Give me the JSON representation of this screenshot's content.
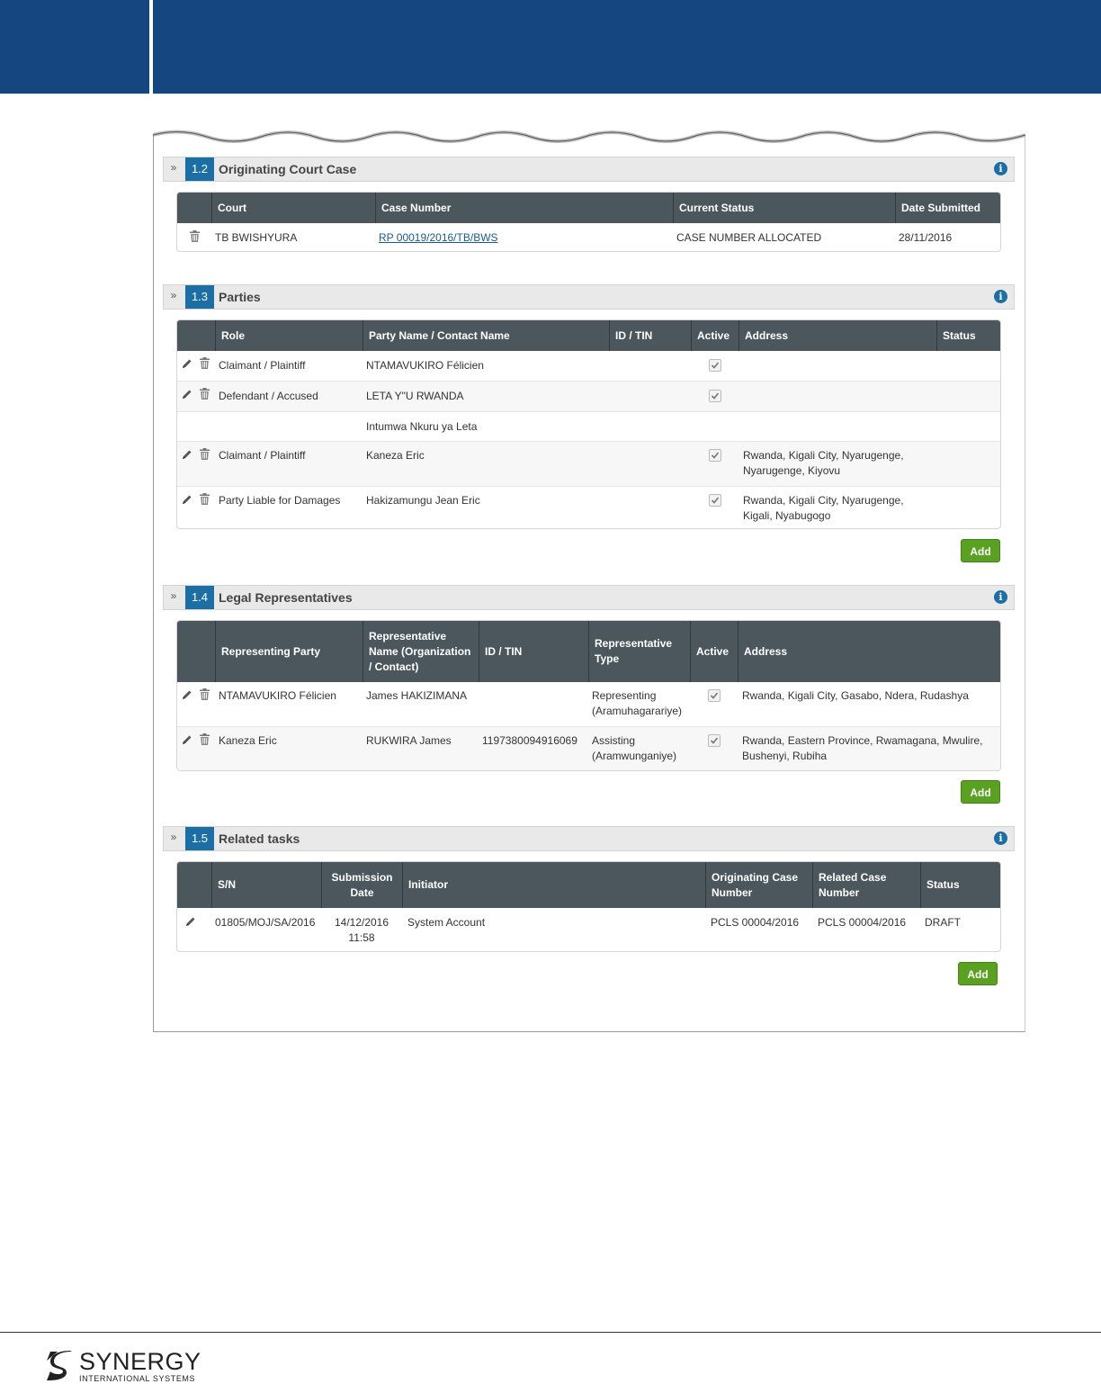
{
  "sections": {
    "s12": {
      "number": "1.2",
      "title": "Originating Court Case",
      "columns": [
        "Court",
        "Case Number",
        "Current Status",
        "Date Submitted"
      ],
      "rows": [
        {
          "court": "TB BWISHYURA",
          "case_number": "RP 00019/2016/TB/BWS",
          "status": "CASE NUMBER ALLOCATED",
          "date": "28/11/2016"
        }
      ]
    },
    "s13": {
      "number": "1.3",
      "title": "Parties",
      "columns": [
        "Role",
        "Party Name / Contact Name",
        "ID / TIN",
        "Active",
        "Address",
        "Status"
      ],
      "rows": [
        {
          "role": "Claimant / Plaintiff",
          "name": "NTAMAVUKIRO Félicien",
          "address1": "",
          "address2": ""
        },
        {
          "role": "Defendant / Accused",
          "name": "LETA Y\"U RWANDA",
          "address1": "",
          "address2": ""
        },
        {
          "role": "",
          "name": "Intumwa Nkuru ya Leta",
          "address1": "",
          "address2": ""
        },
        {
          "role": "Claimant / Plaintiff",
          "name": "Kaneza Eric",
          "address1": "Rwanda, Kigali City, Nyarugenge,",
          "address2": "Nyarugenge, Kiyovu"
        },
        {
          "role": "Party Liable for Damages",
          "name": "Hakizamungu Jean Eric",
          "address1": "Rwanda, Kigali City, Nyarugenge,",
          "address2": "Kigali, Nyabugogo"
        }
      ],
      "add_label": "Add"
    },
    "s14": {
      "number": "1.4",
      "title": "Legal Representatives",
      "columns": {
        "party": "Representing Party",
        "name1": "Representative",
        "name2": "Name (Organization",
        "name3": "/ Contact)",
        "id": "ID / TIN",
        "type1": "Representative",
        "type2": "Type",
        "active": "Active",
        "address": "Address"
      },
      "rows": [
        {
          "party": "NTAMAVUKIRO Félicien",
          "name": "James HAKIZIMANA",
          "id": "",
          "type1": "Representing",
          "type2": "(Aramuhagarariye)",
          "address1": "Rwanda, Kigali City, Gasabo, Ndera, Rudashya",
          "address2": ""
        },
        {
          "party": "Kaneza Eric",
          "name": "RUKWIRA James",
          "id": "1197380094916069",
          "type1": "Assisting",
          "type2": "(Aramwunganiye)",
          "address1": "Rwanda, Eastern Province, Rwamagana, Mwulire,",
          "address2": "Bushenyi, Rubiha"
        }
      ],
      "add_label": "Add"
    },
    "s15": {
      "number": "1.5",
      "title": "Related tasks",
      "columns": {
        "sn": "S/N",
        "sub1": "Submission",
        "sub2": "Date",
        "initiator": "Initiator",
        "orig1": "Originating Case",
        "orig2": "Number",
        "rel1": "Related Case",
        "rel2": "Number",
        "status": "Status"
      },
      "rows": [
        {
          "sn": "01805/MOJ/SA/2016",
          "date1": "14/12/2016",
          "date2": "11:58",
          "initiator": "System Account",
          "orig": "PCLS 00004/2016",
          "rel": "PCLS 00004/2016",
          "status": "DRAFT"
        }
      ],
      "add_label": "Add"
    }
  },
  "footer": {
    "logo_word": "SYNERGY",
    "logo_sub": "INTERNATIONAL SYSTEMS"
  },
  "colors": {
    "header_band": "#154680",
    "section_number": "#1b6fa4",
    "table_header": "#4b575c",
    "add_button": "#5aa121"
  }
}
